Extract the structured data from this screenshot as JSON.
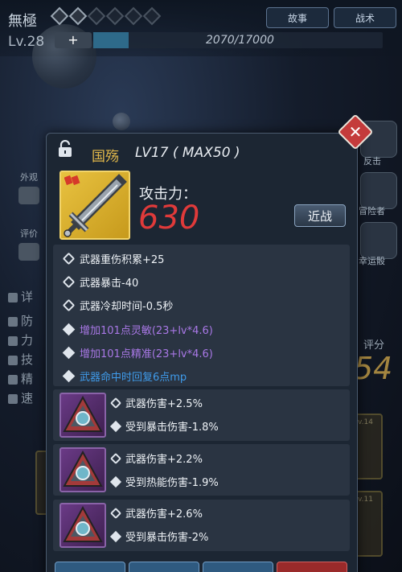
{
  "header": {
    "hero_name": "無極",
    "level": "Lv.28",
    "plus_label": "+",
    "exp_text": "2070/17000",
    "exp_progress": 0.1218,
    "story_label": "故事",
    "tactic_label": "战术"
  },
  "left_sidebar": {
    "appearance_label": "外观",
    "rating_label": "评价",
    "details_label": "详",
    "detail_items": [
      "防",
      "力",
      "技",
      "精",
      "速"
    ]
  },
  "right_sidebar": {
    "counter_label": "反击",
    "adventurer_label": "冒险者",
    "lucky_label": "幸运骰",
    "score_label": "评分",
    "score_value": "54",
    "card_level_1": "Lv.14",
    "card_level_2": "Lv.11"
  },
  "weapon": {
    "name": "国殇",
    "level_text": "LV17 ( MAX50 )",
    "attack_label": "攻击力：",
    "attack_value": "630",
    "melee_label": "近战"
  },
  "stats": [
    {
      "text": "武器重伤积累+25",
      "style": "white",
      "mark": "gear"
    },
    {
      "text": "武器暴击-40",
      "style": "white",
      "mark": "gear"
    },
    {
      "text": "武器冷却时间-0.5秒",
      "style": "white",
      "mark": "gear"
    },
    {
      "text": "增加101点灵敏(23+lv*4.6)",
      "style": "purple",
      "mark": "dia"
    },
    {
      "text": "增加101点精准(23+lv*4.6)",
      "style": "purple",
      "mark": "dia"
    },
    {
      "text": "武器命中时回复6点mp",
      "style": "blue",
      "mark": "dia"
    }
  ],
  "gems": [
    {
      "line1": "武器伤害+2.5%",
      "line2": "受到暴击伤害-1.8%"
    },
    {
      "line1": "武器伤害+2.2%",
      "line2": "受到热能伤害-1.9%"
    },
    {
      "line1": "武器伤害+2.6%",
      "line2": "受到暴击伤害-2%"
    }
  ],
  "colors": {
    "accent_gold": "#e2b84a",
    "attack_red": "#e03a3a",
    "stat_purple": "#a978e6",
    "stat_blue": "#3f9bea",
    "close_red": "#c43b3b"
  }
}
